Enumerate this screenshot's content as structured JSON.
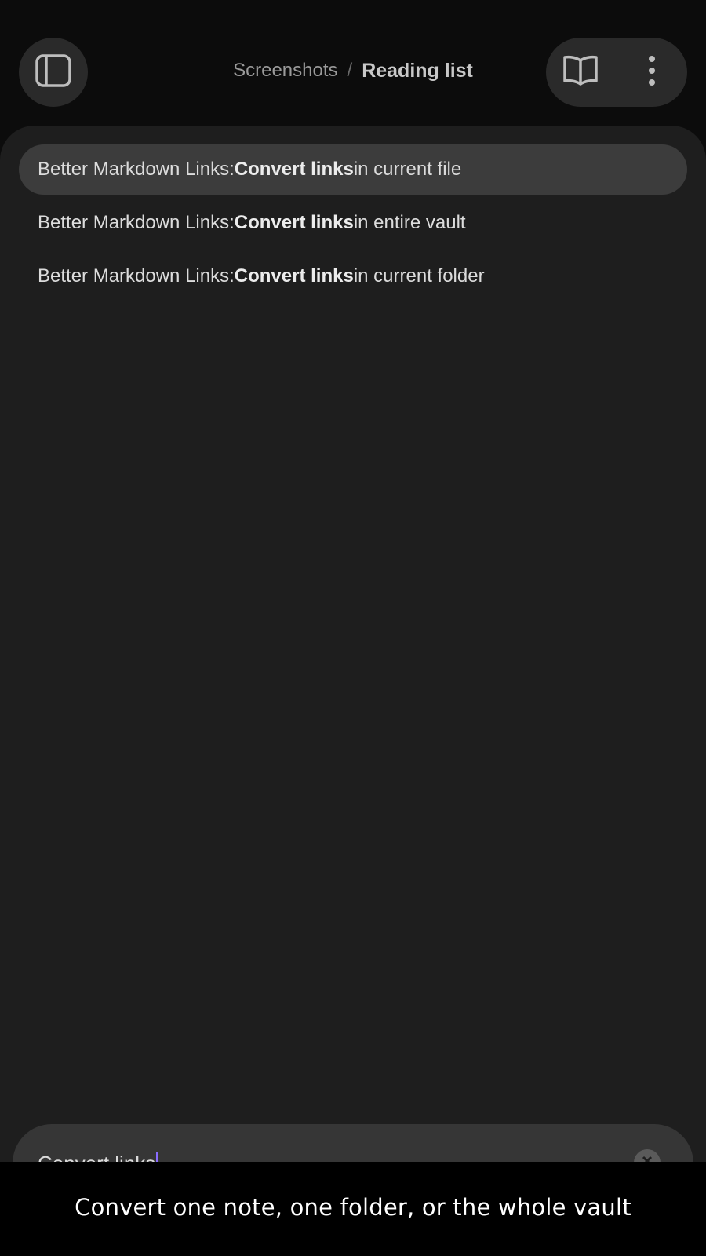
{
  "header": {
    "breadcrumb_parent": "Screenshots",
    "breadcrumb_separator": "/",
    "breadcrumb_current": "Reading list",
    "left_icon": "sidebar-toggle-icon",
    "right_icons": [
      "book-open-icon",
      "more-vertical-icon"
    ]
  },
  "suggestions": [
    {
      "prefix": "Better Markdown Links: ",
      "match": "Convert links",
      "suffix": " in current file",
      "selected": true
    },
    {
      "prefix": "Better Markdown Links: ",
      "match": "Convert links",
      "suffix": " in entire vault",
      "selected": false
    },
    {
      "prefix": "Better Markdown Links: ",
      "match": "Convert links",
      "suffix": " in current folder",
      "selected": false
    }
  ],
  "search": {
    "value": "Convert links",
    "clear_icon": "clear-icon"
  },
  "caption": "Convert one note, one folder, or the whole vault",
  "colors": {
    "background": "#0c0c0c",
    "panel": "#1e1e1e",
    "selected_row": "#3c3c3c",
    "caret": "#8a6cff"
  }
}
